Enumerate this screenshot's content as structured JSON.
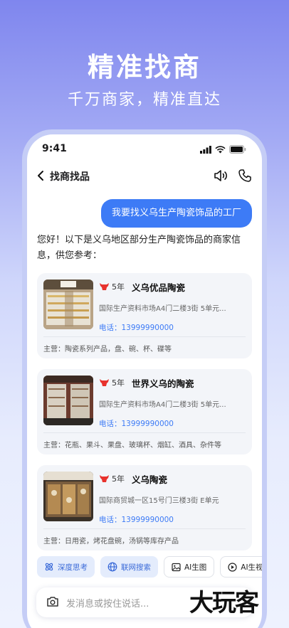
{
  "hero": {
    "title": "精准找商",
    "subtitle": "千万商家，精准直达"
  },
  "status": {
    "time": "9:41"
  },
  "nav": {
    "title": "找商找品"
  },
  "chat": {
    "user_message": "我要找义乌生产陶瓷饰品的工厂",
    "ai_reply": "您好！以下是义乌地区部分生产陶瓷饰品的商家信息，供您参考："
  },
  "merchants": [
    {
      "years": "5年",
      "name": "义乌优品陶瓷",
      "address": "国际生产资料市场A4门二楼3街 5单元...",
      "phone": "电话：13999990000",
      "main": "主营：陶瓷系列产品，盘、碗、杯、碟等"
    },
    {
      "years": "5年",
      "name": "世界义乌的陶瓷",
      "address": "国际生产资料市场A4门二楼3街 5单元...",
      "phone": "电话：13999990000",
      "main": "主营：花瓶、果斗、果盘、玻璃杯、烟缸、酒具、杂件等"
    },
    {
      "years": "5年",
      "name": "义乌陶瓷",
      "address": "国际商贸城一区15号门三楼3街 E单元",
      "phone": "电话：13999990000",
      "main": "主营：日用瓷，烤花盘碗，汤锅等库存产品"
    }
  ],
  "chips": [
    {
      "label": "深度思考",
      "icon": "atom-icon"
    },
    {
      "label": "联网搜索",
      "icon": "globe-icon"
    },
    {
      "label": "AI生图",
      "icon": "image-icon"
    },
    {
      "label": "AI生视频",
      "icon": "video-icon"
    }
  ],
  "input": {
    "placeholder": "发消息或按住说话..."
  },
  "watermark": "大玩客",
  "colors": {
    "accent": "#3d7bf6",
    "badge": "#e8322d"
  }
}
